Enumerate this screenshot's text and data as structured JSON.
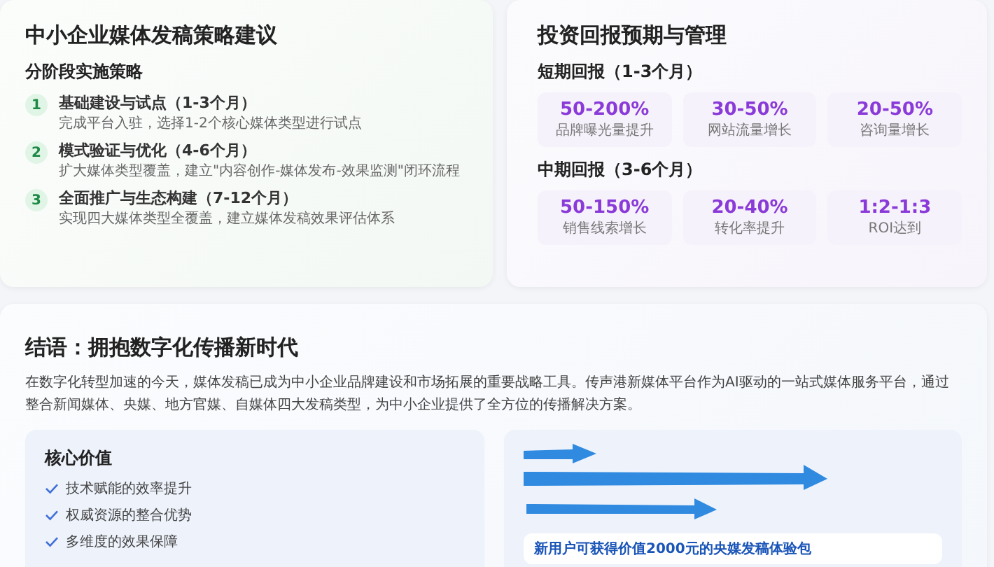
{
  "strategy": {
    "title": "中小企业媒体发稿策略建议",
    "subtitle": "分阶段实施策略",
    "phases": [
      {
        "number": "1",
        "title": "基础建设与试点（1-3个月）",
        "description": "完成平台入驻，选择1-2个核心媒体类型进行试点"
      },
      {
        "number": "2",
        "title": "模式验证与优化（4-6个月）",
        "description": "扩大媒体类型覆盖，建立\"内容创作-媒体发布-效果监测\"闭环流程"
      },
      {
        "number": "3",
        "title": "全面推广与生态构建（7-12个月）",
        "description": "实现四大媒体类型全覆盖，建立媒体发稿效果评估体系"
      }
    ]
  },
  "roi": {
    "title": "投资回报预期与管理",
    "groups": [
      {
        "heading": "短期回报（1-3个月）",
        "stats": [
          {
            "value": "50-200%",
            "label": "品牌曝光量提升"
          },
          {
            "value": "30-50%",
            "label": "网站流量增长"
          },
          {
            "value": "20-50%",
            "label": "咨询量增长"
          }
        ]
      },
      {
        "heading": "中期回报（3-6个月）",
        "stats": [
          {
            "value": "50-150%",
            "label": "销售线索增长"
          },
          {
            "value": "20-40%",
            "label": "转化率提升"
          },
          {
            "value": "1:2-1:3",
            "label": "ROI达到"
          }
        ]
      }
    ]
  },
  "conclusion": {
    "title": "结语：拥抱数字化传播新时代",
    "paragraph": "在数字化转型加速的今天，媒体发稿已成为中小企业品牌建设和市场拓展的重要战略工具。传声港新媒体平台作为AI驱动的一站式媒体服务平台，通过整合新闻媒体、央媒、地方官媒、自媒体四大发稿类型，为中小企业提供了全方位的传播解决方案。",
    "core_value": {
      "title": "核心价值",
      "items": [
        "技术赋能的效率提升",
        "权威资源的整合优势",
        "多维度的效果保障"
      ]
    },
    "promo": {
      "text": "新用户可获得价值2000元的央媒发稿体验包"
    }
  }
}
